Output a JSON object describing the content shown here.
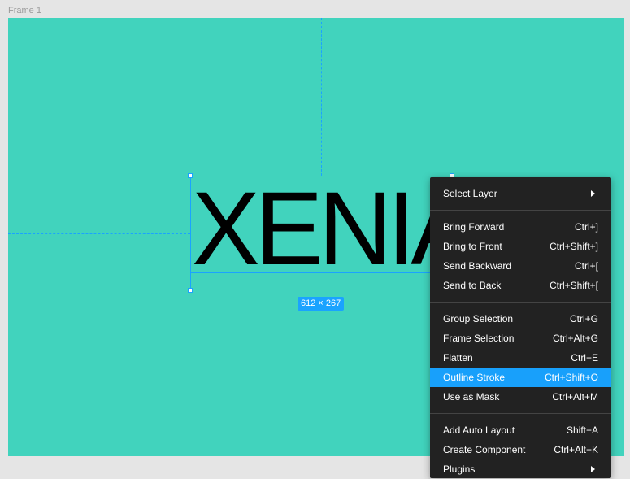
{
  "frame": {
    "label": "Frame 1"
  },
  "canvas": {
    "text": "XENIA",
    "size_badge": "612 × 267",
    "background": "#41d3bd",
    "selection_color": "#1aa3ff"
  },
  "context_menu": {
    "groups": [
      [
        {
          "label": "Select Layer",
          "shortcut": "",
          "submenu": true
        }
      ],
      [
        {
          "label": "Bring Forward",
          "shortcut": "Ctrl+]"
        },
        {
          "label": "Bring to Front",
          "shortcut": "Ctrl+Shift+]"
        },
        {
          "label": "Send Backward",
          "shortcut": "Ctrl+["
        },
        {
          "label": "Send to Back",
          "shortcut": "Ctrl+Shift+["
        }
      ],
      [
        {
          "label": "Group Selection",
          "shortcut": "Ctrl+G"
        },
        {
          "label": "Frame Selection",
          "shortcut": "Ctrl+Alt+G"
        },
        {
          "label": "Flatten",
          "shortcut": "Ctrl+E"
        },
        {
          "label": "Outline Stroke",
          "shortcut": "Ctrl+Shift+O",
          "active": true
        },
        {
          "label": "Use as Mask",
          "shortcut": "Ctrl+Alt+M"
        }
      ],
      [
        {
          "label": "Add Auto Layout",
          "shortcut": "Shift+A"
        },
        {
          "label": "Create Component",
          "shortcut": "Ctrl+Alt+K"
        },
        {
          "label": "Plugins",
          "shortcut": "",
          "submenu": true
        }
      ]
    ]
  }
}
